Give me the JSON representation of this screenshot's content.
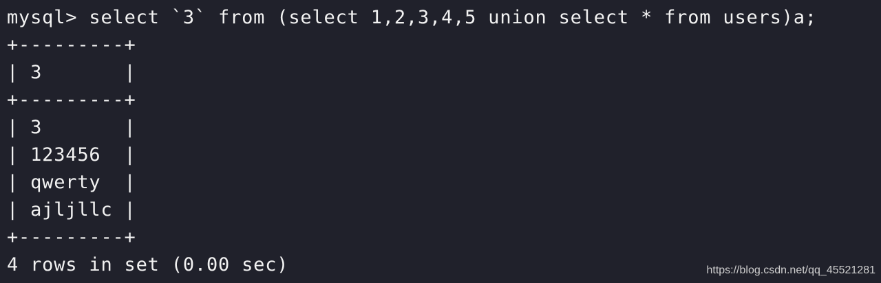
{
  "terminal": {
    "prompt": "mysql>",
    "command": "select `3` from (select 1,2,3,4,5 union select * from users)a;",
    "border": "+---------+",
    "header_row": "| 3       |",
    "rows": [
      "| 3       |",
      "| 123456  |",
      "| qwerty  |",
      "| ajljllc |"
    ],
    "result_summary": "4 rows in set (0.00 sec)"
  },
  "watermark": "https://blog.csdn.net/qq_45521281",
  "colors": {
    "background": "#20212b",
    "text": "#f2f2f2"
  }
}
